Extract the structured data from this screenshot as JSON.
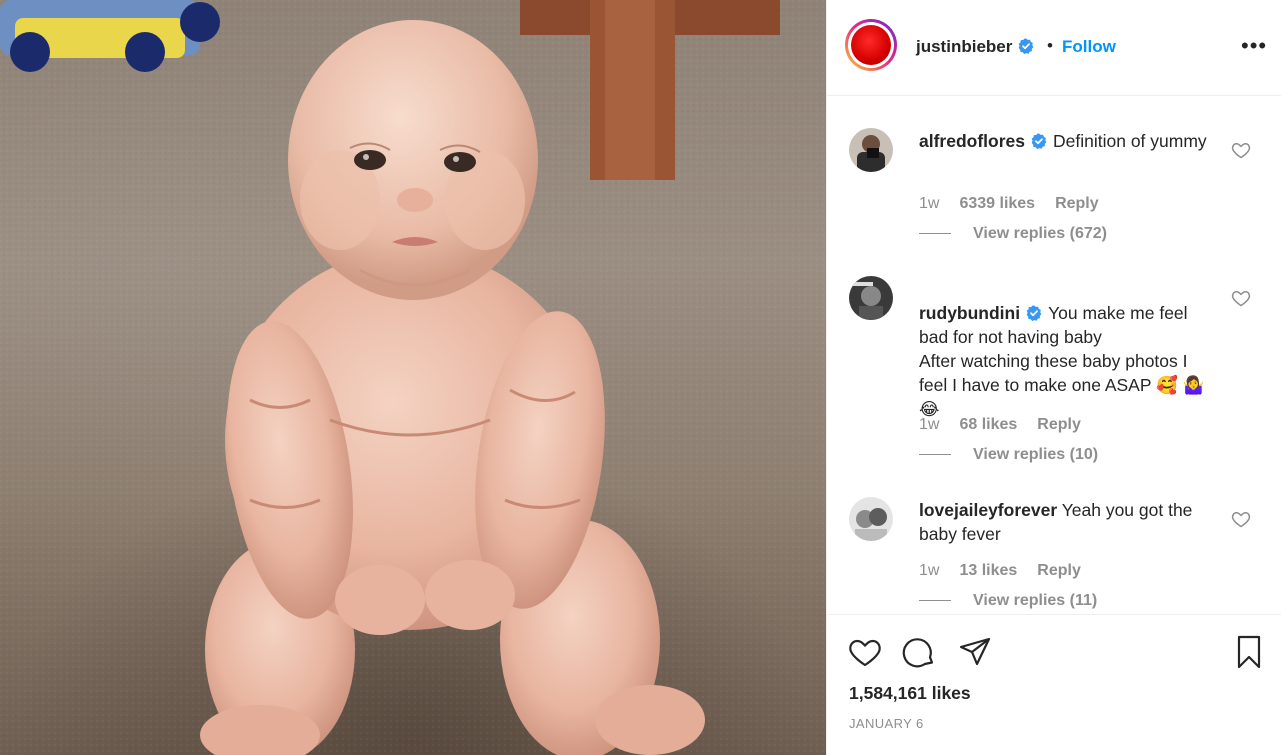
{
  "post": {
    "username": "justinbieber",
    "follow_label": "Follow",
    "separator": "•",
    "more_label": "•••"
  },
  "comments": [
    {
      "username": "alfredoflores",
      "verified": true,
      "text": "Definition of yummy",
      "age": "1w",
      "likes": "6339 likes",
      "reply_label": "Reply",
      "view_replies": "View replies (672)"
    },
    {
      "username": "rudybundini",
      "verified": true,
      "text": "You make me feel bad for not having baby\nAfter watching these baby photos I feel I have to make one ASAP 🥰 🤷‍♀️😂",
      "age": "1w",
      "likes": "68 likes",
      "reply_label": "Reply",
      "view_replies": "View replies (10)"
    },
    {
      "username": "lovejaileyforever",
      "verified": false,
      "text": "Yeah you got the baby fever",
      "age": "1w",
      "likes": "13 likes",
      "reply_label": "Reply",
      "view_replies": "View replies (11)"
    }
  ],
  "footer": {
    "likes": "1,584,161 likes",
    "date": "JANUARY 6"
  },
  "icons": {
    "like": "heart-icon",
    "comment": "comment-icon",
    "share": "share-icon",
    "save": "bookmark-icon",
    "more": "more-options-icon",
    "verified": "verified-badge-icon"
  },
  "colors": {
    "accent": "#0095f6",
    "verified": "#3897f0",
    "secondary_text": "#8e8e8e",
    "primary_text": "#262626"
  }
}
